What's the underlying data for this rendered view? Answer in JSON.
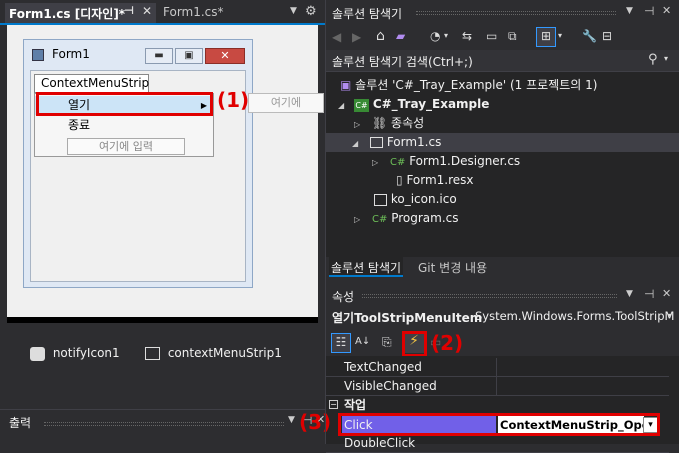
{
  "designer": {
    "tab_active": "Form1.cs [디자인]*",
    "tab_other": "Form1.cs*",
    "form_title": "Form1",
    "menustrip_label": "ContextMenuStrip",
    "menu_items": [
      "열기",
      "종료"
    ],
    "type_here": "여기에 입력",
    "submenu_type_here": "여기에",
    "tray_components": [
      "notifyIcon1",
      "contextMenuStrip1"
    ]
  },
  "output": {
    "title": "출력"
  },
  "solution": {
    "title": "솔루션 탐색기",
    "search_placeholder": "솔루션 탐색기 검색(Ctrl+;)",
    "solution_label": "솔루션 'C#_Tray_Example' (1 프로젝트의 1)",
    "project": "C#_Tray_Example",
    "dependencies": "종속성",
    "form_file": "Form1.cs",
    "designer_file": "Form1.Designer.cs",
    "resx_file": "Form1.resx",
    "ico_file": "ko_icon.ico",
    "program_file": "Program.cs",
    "bottom_tabs": [
      "솔루션 탐색기",
      "Git 변경 내용"
    ]
  },
  "properties": {
    "title": "속성",
    "object_name": "열기ToolStripMenuItem",
    "object_type": "System.Windows.Forms.ToolStripM",
    "rows_top": [
      "TextChanged",
      "VisibleChanged"
    ],
    "category": "작업",
    "selected_name": "Click",
    "selected_value": "ContextMenuStrip_Open",
    "next_row": "DoubleClick"
  },
  "annotations": [
    "(1)",
    "(2)",
    "(3)"
  ],
  "colors": {
    "accent_purple": "#7160e8",
    "highlight_red": "#e00000",
    "panel_bg": "#252526",
    "designer_bg": "#f0f0f0"
  }
}
